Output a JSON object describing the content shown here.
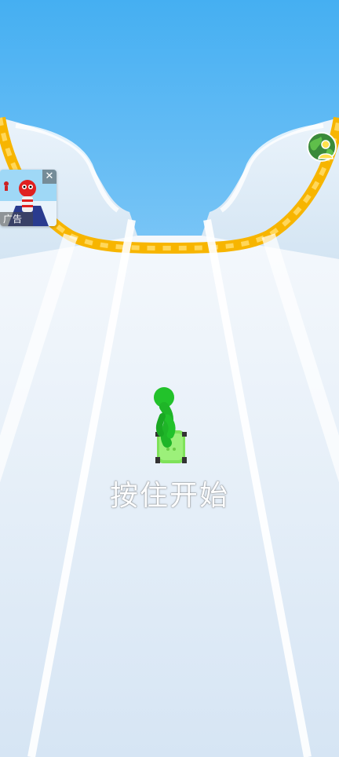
{
  "game": {
    "start_prompt": "按住开始",
    "ad": {
      "label": "广告",
      "close_glyph": "✕"
    },
    "avatar_button": {
      "icon": "character-select-icon"
    }
  },
  "colors": {
    "sky": "#4fb4f3",
    "track": "#dce8f5",
    "rail": "#f7b500",
    "player": "#22c22b",
    "skateboard": "#8fe86a"
  }
}
